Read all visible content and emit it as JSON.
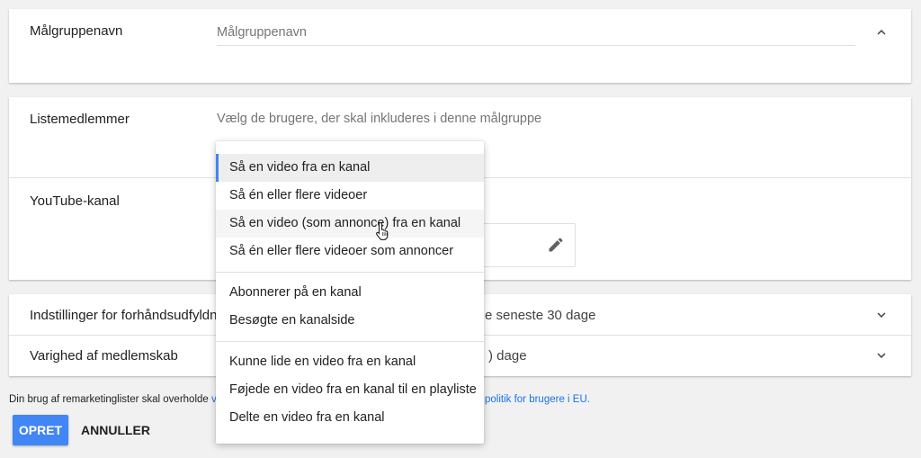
{
  "audience_name": {
    "label": "Målgruppenavn",
    "placeholder": "Målgruppenavn"
  },
  "list_members": {
    "label": "Listemedlemmer",
    "hint": "Vælg de brugere, der skal inkluderes i denne målgruppe"
  },
  "youtube_channel": {
    "label": "YouTube-kanal"
  },
  "prefill": {
    "label": "Indstillinger for forhåndsudfyldni",
    "value_fragment": "e seneste 30 dage"
  },
  "duration": {
    "label": "Varighed af medlemskab",
    "value_fragment": ") dage"
  },
  "dropdown": {
    "group1": [
      "Så en video fra en kanal",
      "Så én eller flere videoer",
      "Så en video (som annonce) fra en kanal",
      "Så én eller flere videoer som annoncer"
    ],
    "group2": [
      "Abonnerer på en kanal",
      "Besøgte en kanalside"
    ],
    "group3": [
      "Kunne lide en video fra en kanal",
      "Føjede en video fra en kanal til en playliste",
      "Delte en video fra en kanal"
    ]
  },
  "footer": {
    "text_prefix": "Din brug af remarketinglister skal overholde",
    "link_fragment_left": "v",
    "link_fragment_right": "politik for brugere i EU."
  },
  "actions": {
    "create": "OPRET",
    "cancel": "ANNULLER"
  },
  "colors": {
    "accent": "#4285f4",
    "link": "#1a73e8"
  },
  "icons": {
    "collapse": "chevron-up-icon",
    "expand": "chevron-down-icon",
    "edit": "pencil-icon"
  }
}
